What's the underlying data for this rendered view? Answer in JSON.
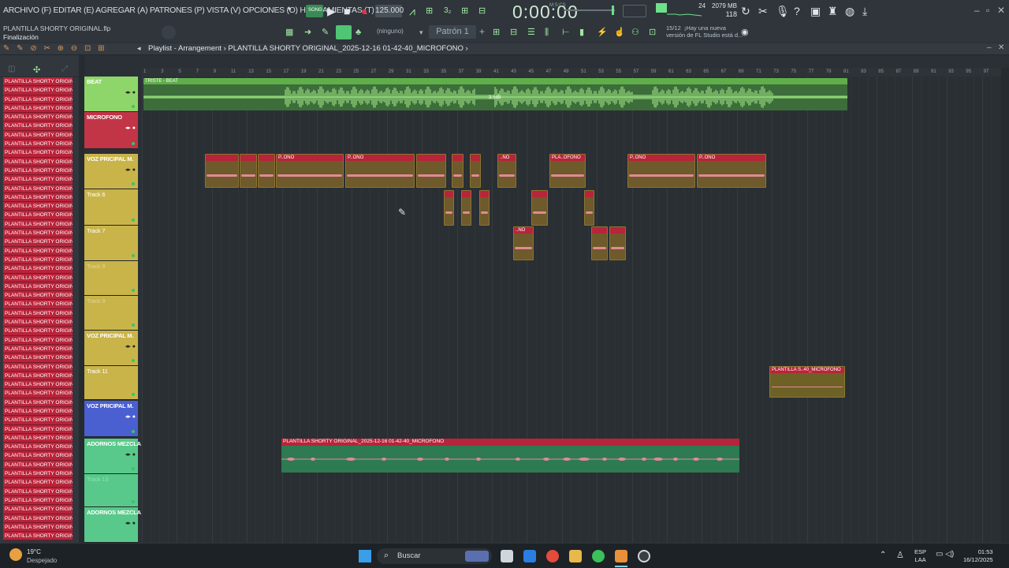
{
  "menu": {
    "text": "ARCHIVO (F) EDITAR (E) AGREGAR (A) PATRONES (P) VISTA (V) OPCIONES (O) HERRAMIENTAS (T) AYUDA"
  },
  "transport": {
    "song_label": "SONG",
    "tempo": "125.000",
    "timecode": "0:00:00",
    "timecode_unit": "M:S:CS"
  },
  "cpu": {
    "memory": "2079 MB",
    "polyphony": "118",
    "cores": "24"
  },
  "project": {
    "name": "PLANTILLA SHORTY ORIGINAL.flp",
    "status": "Finalización"
  },
  "toolbar2": {
    "snap": "(ninguno)",
    "pattern": "Patrón 1",
    "news": "15/12  ¡Hay una nueva\nversión de FL Studio está d..."
  },
  "playlist": {
    "title": "Playlist - Arrangement  ›  PLANTILLA SHORTY ORIGINAL_2025-12-16 01-42-40_MICROFONO  ›"
  },
  "browser": {
    "item_label": "PLANTILLA SHORTY ORIGINA"
  },
  "ruler": {
    "ticks": [
      "1",
      "3",
      "5",
      "7",
      "9",
      "11",
      "13",
      "15",
      "17",
      "19",
      "21",
      "23",
      "25",
      "27",
      "29",
      "31",
      "33",
      "35",
      "37",
      "39",
      "41",
      "43",
      "45",
      "47",
      "49",
      "51",
      "53",
      "55",
      "57",
      "59",
      "61",
      "63",
      "65",
      "67",
      "69",
      "71",
      "73",
      "75",
      "77",
      "79",
      "81",
      "83",
      "85",
      "87",
      "89",
      "91",
      "93",
      "95",
      "97"
    ]
  },
  "tracks": [
    {
      "name": "BEAT",
      "color": "#8fd66a"
    },
    {
      "name": "MICROFONO",
      "color": "#c23546"
    },
    {
      "name": "VOZ PRICIPAL M.",
      "color": "#c9b44a"
    },
    {
      "name": "Track 6",
      "color": "#c9b44a"
    },
    {
      "name": "Track 7",
      "color": "#c9b44a"
    },
    {
      "name": "Track 8",
      "color": "#c9b44a"
    },
    {
      "name": "Track 9",
      "color": "#c9b44a"
    },
    {
      "name": "VOZ PRICIPAL M.",
      "color": "#c9b44a"
    },
    {
      "name": "Track 11",
      "color": "#c9b44a"
    },
    {
      "name": "VOZ PRICIPAL M.",
      "color": "#4a5fd0"
    },
    {
      "name": "ADORNOS MEZCLA",
      "color": "#58c98a"
    },
    {
      "name": "Track 13",
      "color": "#58c98a"
    },
    {
      "name": "ADORNOS MEZCLA",
      "color": "#58c98a"
    }
  ],
  "clips": {
    "beat": "TRISTE - BEAT",
    "beat_gain": "3.5dB",
    "vocal_a": "P..ONO",
    "vocal_b": "PLA..OFONO",
    "vocal_c": "..NO",
    "mic_11": "PLANTILLA S..40_MICROFONO",
    "mic_adornos": "PLANTILLA SHORTY ORIGINAL_2025-12-16 01-42-40_MICROFONO"
  },
  "taskbar": {
    "temperature": "19°C",
    "weather": "Despejado",
    "search": "Buscar",
    "lang_top": "ESP",
    "lang_bottom": "LAA",
    "time": "01:53",
    "date": "16/12/2025"
  },
  "colors": {
    "accent": "#6fe08a",
    "beat": "#8fd66a",
    "vocal_clip": "#b8243a",
    "adornos": "#3aa36a"
  }
}
